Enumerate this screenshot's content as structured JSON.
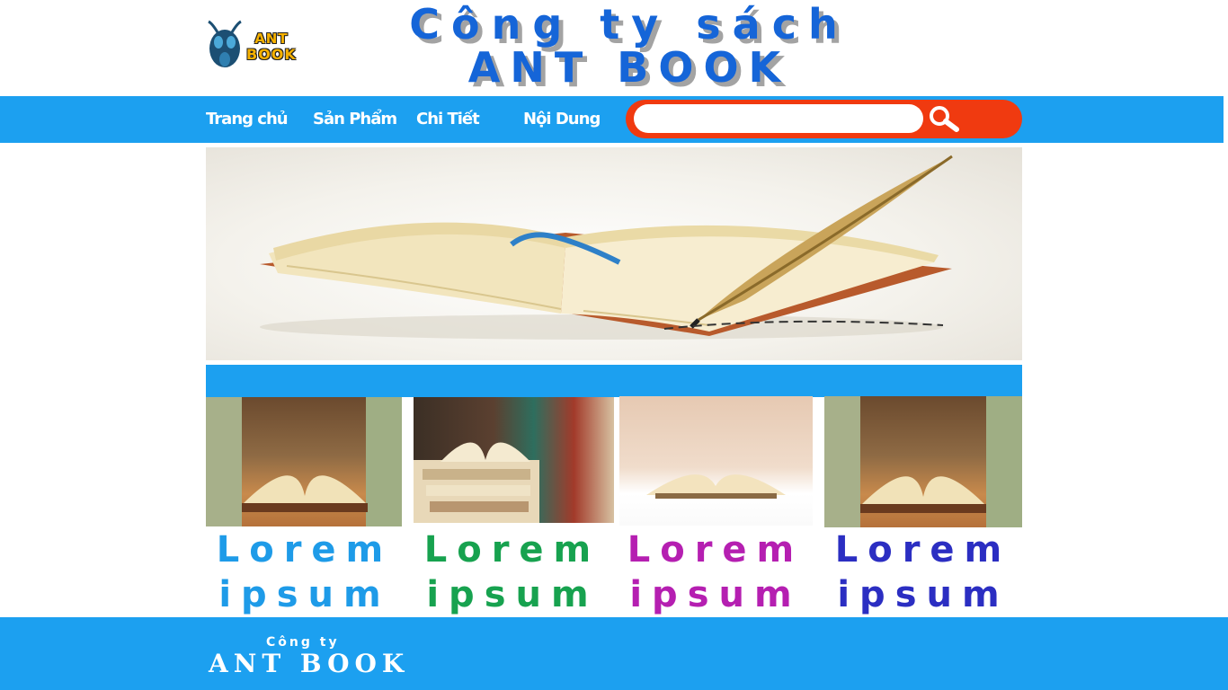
{
  "header": {
    "logo": {
      "line1": "ANT",
      "line2": "BOOK"
    },
    "title_line1": "Công ty sách",
    "title_line2": "ANT BOOK"
  },
  "nav": {
    "items": [
      {
        "label": "Trang chủ"
      },
      {
        "label": "Sản Phẩm"
      },
      {
        "label": "Chi Tiết"
      },
      {
        "label": "Nội Dung"
      }
    ],
    "search": {
      "value": "",
      "placeholder": "",
      "icon": "search-icon"
    }
  },
  "banner": {
    "image": "open book with quill pen"
  },
  "products": [
    {
      "line1": "Lorem",
      "line2": "ipsum",
      "color": "#1e9be8"
    },
    {
      "line1": "Lorem",
      "line2": "ipsum",
      "color": "#17a24f"
    },
    {
      "line1": "Lorem",
      "line2": "ipsum",
      "color": "#b51fb1"
    },
    {
      "line1": "Lorem",
      "line2": "ipsum",
      "color": "#2b2ec2"
    }
  ],
  "footer": {
    "small": "Công ty",
    "big": "ANT BOOK"
  },
  "colors": {
    "accent": "#1ca0f0",
    "search_bg": "#f03a10",
    "title": "#1565d8"
  }
}
